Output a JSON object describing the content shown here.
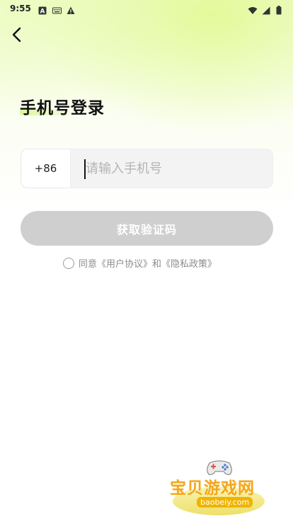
{
  "status_bar": {
    "time": "9:55",
    "left_icons": [
      "a-icon",
      "keyboard-icon",
      "warning-icon"
    ],
    "right_icons": [
      "wifi-icon",
      "signal-icon",
      "battery-icon"
    ]
  },
  "header": {
    "back_icon": "chevron-left-icon"
  },
  "page": {
    "title": "手机号登录"
  },
  "login_form": {
    "country_code": "+86",
    "phone_placeholder": "请输入手机号",
    "phone_value": "",
    "get_code_label": "获取验证码"
  },
  "agreement": {
    "prefix": "同意",
    "user_agreement": "《用户协议》",
    "conjunction": "和",
    "privacy_policy": "《隐私政策》"
  },
  "watermark": {
    "name": "宝贝游戏网",
    "url": "baobeiy.com"
  },
  "colors": {
    "accent_gradient": "#e2fa96",
    "button_disabled": "#cfcfcf",
    "watermark_orange": "#f4a51d"
  }
}
